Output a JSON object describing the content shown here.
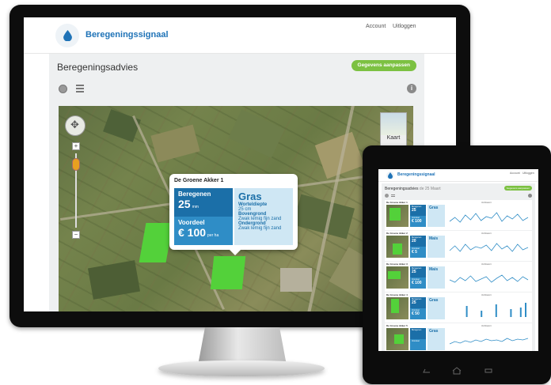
{
  "monitor": {
    "header": {
      "brand": "Beregeningssignaal",
      "account_link": "Account",
      "logout_link": "Uitloggen"
    },
    "page": {
      "title": "Beregeningsadvies",
      "edit_button": "Gegevens aanpassen"
    },
    "map": {
      "map_type_button": "Kaart",
      "popup": {
        "field_name": "De Groene Akker 1",
        "advice_label": "Beregenen",
        "advice_value": "25",
        "advice_unit": "mm",
        "benefit_label": "Voordeel",
        "benefit_value": "€ 100",
        "benefit_unit": "per ha",
        "crop": "Gras",
        "root_depth_label": "Worteldiepte",
        "root_depth_value": "25 cm",
        "topsoil_label": "Bovengrond",
        "topsoil_value": "Zwak lemig fijn zand",
        "subsoil_label": "Ondergrond",
        "subsoil_value": "Zwak lemig fijn zand"
      }
    }
  },
  "tablet": {
    "header": {
      "brand": "Beregeningssignaal",
      "account_link": "Account",
      "logout_link": "Uitloggen"
    },
    "page": {
      "title": "Beregeningsadvies",
      "subtitle": "de 25 Maart",
      "edit_button": "Gegevens aanpassen"
    },
    "rows": [
      {
        "title": "De Groene Akker 1",
        "advice_label": "Beregenen",
        "advice_value": "25",
        "benefit_label": "Voordeel",
        "benefit_value": "€ 100",
        "crop": "Gras",
        "chart_label": "Vochttekort"
      },
      {
        "title": "De Groene Akker 2",
        "advice_label": "Beregenen",
        "advice_value": "20",
        "benefit_label": "Voordeel",
        "benefit_value": "€ 5",
        "crop": "Mais",
        "chart_label": "Vochttekort"
      },
      {
        "title": "De Groene Akker 3",
        "advice_label": "Beregenen",
        "advice_value": "25",
        "benefit_label": "Voordeel",
        "benefit_value": "€ 100",
        "crop": "Mais",
        "chart_label": "Vochttekort"
      },
      {
        "title": "De Groene Akker 4",
        "advice_label": "Beregenen",
        "advice_value": "25",
        "benefit_label": "Voordeel",
        "benefit_value": "€ 50",
        "crop": "Gras",
        "chart_label": "Vochttekort"
      },
      {
        "title": "De Groene Akker 5",
        "advice_label": "Beregenen",
        "advice_value": "",
        "benefit_label": "Voordeel",
        "benefit_value": "",
        "crop": "Gras",
        "chart_label": "Vochttekort"
      }
    ]
  },
  "colors": {
    "brand_blue": "#1f73b7",
    "advice_blue": "#1b6fa8",
    "benefit_blue": "#2f8dc6",
    "info_bg": "#cfe7f4",
    "button_green": "#7cc142",
    "field_green": "#53d13a"
  },
  "icons": [
    "water-drop-icon",
    "map-view-icon",
    "list-view-icon",
    "info-icon",
    "pan-control-icon",
    "zoom-in-icon",
    "zoom-out-icon"
  ]
}
